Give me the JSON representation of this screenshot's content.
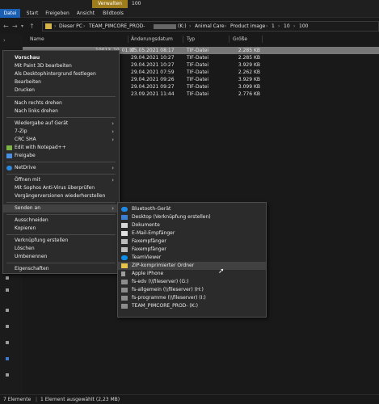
{
  "ribbon": {
    "manage_tab": "Verwalten",
    "window_title": "100",
    "tabs": [
      "Datei",
      "Start",
      "Freigeben",
      "Ansicht",
      "Bildtools"
    ]
  },
  "address": {
    "crumbs": [
      "Dieser PC",
      "TEAM_PIMCORE_PROD-",
      "(K:)",
      "Animal Care",
      "Product image",
      "1",
      "10",
      "100"
    ]
  },
  "columns": {
    "name": "Name",
    "date": "Änderungsdatum",
    "type": "Typ",
    "size": "Größe"
  },
  "files": [
    {
      "name": "10013_10_01.tif",
      "date": "05.05.2021 08:17",
      "type": "TIF-Datei",
      "size": "2.285 KB"
    },
    {
      "name": "",
      "date": "29.04.2021 10:27",
      "type": "TIF-Datei",
      "size": "2.285 KB"
    },
    {
      "name": "",
      "date": "29.04.2021 10:27",
      "type": "TIF-Datei",
      "size": "3.929 KB"
    },
    {
      "name": "",
      "date": "29.04.2021 07:59",
      "type": "TIF-Datei",
      "size": "2.262 KB"
    },
    {
      "name": "",
      "date": "29.04.2021 09:26",
      "type": "TIF-Datei",
      "size": "3.929 KB"
    },
    {
      "name": "",
      "date": "29.04.2021 09:27",
      "type": "TIF-Datei",
      "size": "3.099 KB"
    },
    {
      "name": "",
      "date": "23.09.2021 11:44",
      "type": "TIF-Datei",
      "size": "2.776 KB"
    }
  ],
  "context_menu": {
    "items": [
      "Vorschau",
      "Mit Paint 3D bearbeiten",
      "Als Desktophintergrund festlegen",
      "Bearbeiten",
      "Drucken",
      "Nach rechts drehen",
      "Nach links drehen",
      "Wiedergabe auf Gerät",
      "7-Zip",
      "CRC SHA",
      "Edit with Notepad++",
      "Freigabe",
      "NetDrive",
      "Öffnen mit",
      "Mit Sophos Anti-Virus überprüfen",
      "Vorgängerversionen wiederherstellen",
      "Senden an",
      "Ausschneiden",
      "Kopieren",
      "Verknüpfung erstellen",
      "Löschen",
      "Umbenennen",
      "Eigenschaften"
    ]
  },
  "send_to_menu": {
    "items": [
      "Bluetooth-Gerät",
      "Desktop (Verknüpfung erstellen)",
      "Dokumente",
      "E-Mail-Empfänger",
      "Faxempfänger",
      "Faxempfänger",
      "TeamViewer",
      "ZIP-komprimierter Ordner",
      "Apple iPhone",
      "fs-edv (\\\\fileserver) (G:)",
      "fs-allgemein (\\\\fileserver) (H:)",
      "fs-programme (\\\\fileserver) (I:)",
      "TEAM_PIMCORE_PROD- (K:)"
    ]
  },
  "status": {
    "count": "7 Elemente",
    "selection": "1 Element ausgewählt (2,23 MB)"
  },
  "colors": {
    "manage_tab": "#a07d1c",
    "file_tab": "#1a5fb4",
    "selection": "#777777",
    "folder": "#d4b44a"
  }
}
